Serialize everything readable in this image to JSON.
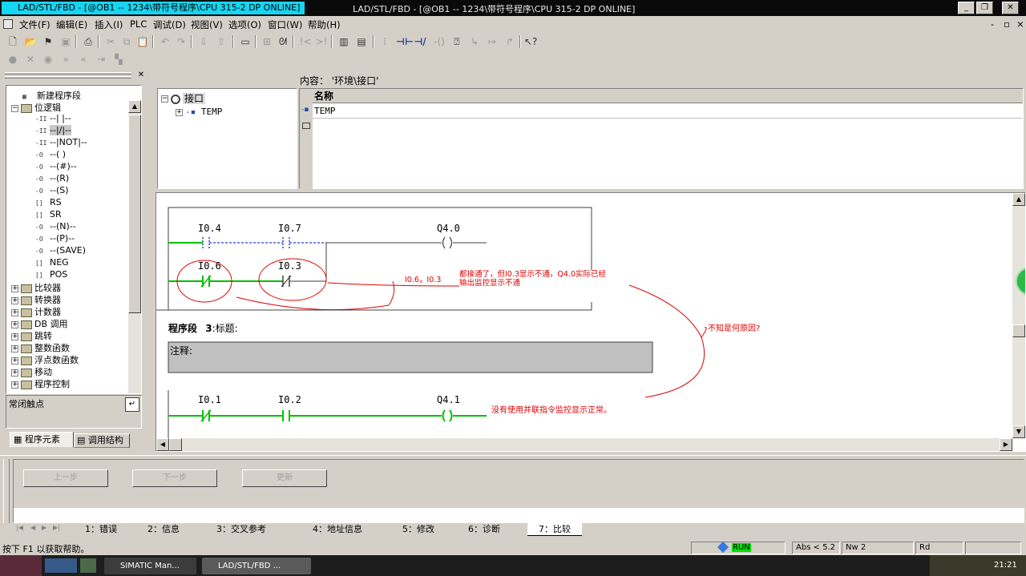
{
  "window": {
    "app_title": "LAD/STL/FBD  - [@OB1 -- 1234\\带符号程序\\CPU 315-2 DP  ONLINE]",
    "center_title": "LAD/STL/FBD  - [@OB1 -- 1234\\带符号程序\\CPU 315-2 DP  ONLINE]",
    "min": "_",
    "restore": "❐",
    "close": "✕"
  },
  "menu": {
    "items": [
      "文件(F)",
      "编辑(E)",
      "插入(I)",
      "PLC",
      "调试(D)",
      "视图(V)",
      "选项(O)",
      "窗口(W)",
      "帮助(H)"
    ],
    "mdi_min": "-",
    "mdi_restore": "▫",
    "mdi_close": "×"
  },
  "left_panel": {
    "tree": [
      {
        "label": "新建程序段",
        "kind": "leaf-icon",
        "glyph": "▦",
        "level": 1
      },
      {
        "label": "位逻辑",
        "kind": "folder-open",
        "level": 0
      },
      {
        "label": "--|  |--",
        "kind": "lad",
        "glyph": "-II",
        "level": 2
      },
      {
        "label": "--|/|--",
        "kind": "lad",
        "glyph": "-II",
        "level": 2,
        "selected": true
      },
      {
        "label": "--|NOT|--",
        "kind": "lad",
        "glyph": "-II",
        "level": 2
      },
      {
        "label": "--( )",
        "kind": "lad",
        "glyph": "-O",
        "level": 2
      },
      {
        "label": "--(#)--",
        "kind": "lad",
        "glyph": "-O",
        "level": 2
      },
      {
        "label": "--(R)",
        "kind": "lad",
        "glyph": "-O",
        "level": 2
      },
      {
        "label": "--(S)",
        "kind": "lad",
        "glyph": "-O",
        "level": 2
      },
      {
        "label": "RS",
        "kind": "lad",
        "glyph": "[]",
        "level": 2
      },
      {
        "label": "SR",
        "kind": "lad",
        "glyph": "[]",
        "level": 2
      },
      {
        "label": "--(N)--",
        "kind": "lad",
        "glyph": "-O",
        "level": 2
      },
      {
        "label": "--(P)--",
        "kind": "lad",
        "glyph": "-O",
        "level": 2
      },
      {
        "label": "--(SAVE)",
        "kind": "lad",
        "glyph": "-O",
        "level": 2
      },
      {
        "label": "NEG",
        "kind": "lad",
        "glyph": "[]",
        "level": 2
      },
      {
        "label": "POS",
        "kind": "lad",
        "glyph": "[]",
        "level": 2
      },
      {
        "label": "比较器",
        "kind": "folder",
        "level": 0
      },
      {
        "label": "转换器",
        "kind": "folder",
        "level": 0
      },
      {
        "label": "计数器",
        "kind": "folder",
        "level": 0
      },
      {
        "label": "DB 调用",
        "kind": "folder",
        "level": 0
      },
      {
        "label": "跳转",
        "kind": "folder",
        "level": 0
      },
      {
        "label": "整数函数",
        "kind": "folder",
        "level": 0
      },
      {
        "label": "浮点数函数",
        "kind": "folder",
        "level": 0
      },
      {
        "label": "移动",
        "kind": "folder",
        "level": 0
      },
      {
        "label": "程序控制",
        "kind": "folder",
        "level": 0
      }
    ],
    "info_text": "常闭触点",
    "tabs": [
      "程序元素",
      "调用结构"
    ]
  },
  "interface": {
    "content_label": "内容：  '环境\\接口'",
    "tree_root": "接口",
    "tree_child": "TEMP",
    "column_header": "名称",
    "rows": [
      "TEMP"
    ]
  },
  "editor": {
    "network2": {
      "rung1": {
        "c1": "I0.4",
        "c2": "I0.7",
        "coil": "Q4.0"
      },
      "rung2": {
        "c1": "I0.6",
        "c2": "I0.3"
      }
    },
    "network3": {
      "title_prefix": "程序段",
      "number": "3",
      "title_label": ":标题:",
      "comment_label": "注释:",
      "c1": "I0.1",
      "c2": "I0.2",
      "coil": "Q4.1"
    },
    "annotations": {
      "a1": "I0.6，I0.3",
      "a2_line1": "都接通了，但I0.3显示不通，Q4.0实际已经",
      "a2_line2": "输出监控显示不通",
      "a3": "不知是何原因?",
      "a4": "没有使用并联指令监控显示正常。"
    }
  },
  "bottom_panel": {
    "buttons": [
      "上一步",
      "下一步",
      "更新"
    ],
    "tabs": [
      "1：错误",
      "2：信息",
      "3：交叉参考",
      "4：地址信息",
      "5：修改",
      "6：诊断",
      "7：比较"
    ],
    "active_tab": "7：比较"
  },
  "status": {
    "help": "按下 F1 以获取帮助。",
    "run": "RUN",
    "abs": "Abs < 5.2",
    "nw": "Nw 2",
    "rd": "Rd"
  },
  "taskbar": {
    "items": [
      "SIMATIC Man...",
      "LAD/STL/FBD ..."
    ],
    "clock": "21:21"
  },
  "colors": {
    "powerflow": "#00c000",
    "no_flow": "#2040d0",
    "annotation": "#e00000",
    "title_highlight": "#15d6f2"
  }
}
